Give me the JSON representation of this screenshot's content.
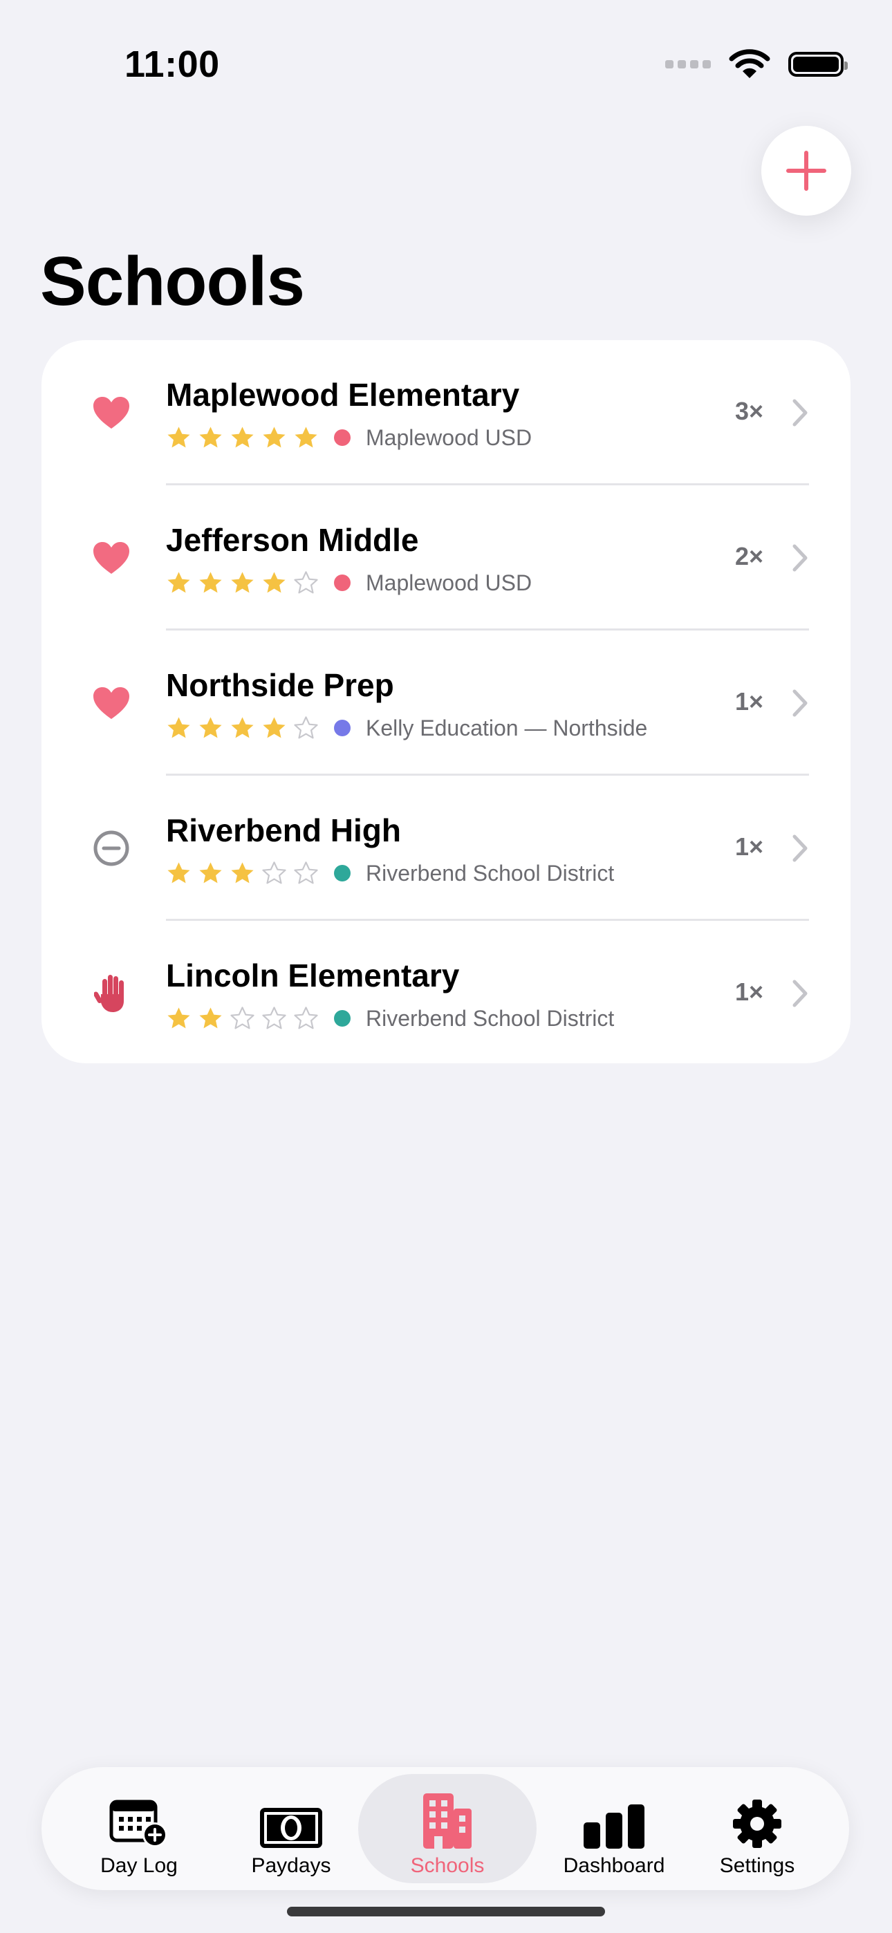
{
  "status_bar": {
    "time": "11:00"
  },
  "header": {
    "title": "Schools",
    "add_icon": "plus-icon"
  },
  "colors": {
    "accent": "#F0647A",
    "star": "#F5C242",
    "favorite": "#F26B81",
    "blocked": "#D6455E",
    "neutral": "#8E8E93"
  },
  "schools": [
    {
      "name": "Maplewood Elementary",
      "rating": 5,
      "status_icon": "heart-icon",
      "district": "Maplewood USD",
      "district_color": "#F0647A",
      "count": "3×"
    },
    {
      "name": "Jefferson Middle",
      "rating": 4,
      "status_icon": "heart-icon",
      "district": "Maplewood USD",
      "district_color": "#F0647A",
      "count": "2×"
    },
    {
      "name": "Northside Prep",
      "rating": 4,
      "status_icon": "heart-icon",
      "district": "Kelly Education — Northside",
      "district_color": "#7679E8",
      "count": "1×"
    },
    {
      "name": "Riverbend High",
      "rating": 3,
      "status_icon": "minus-circle-icon",
      "district": "Riverbend School District",
      "district_color": "#2EA89A",
      "count": "1×"
    },
    {
      "name": "Lincoln Elementary",
      "rating": 2,
      "status_icon": "hand-raised-icon",
      "district": "Riverbend School District",
      "district_color": "#2EA89A",
      "count": "1×"
    }
  ],
  "tabs": [
    {
      "label": "Day Log",
      "icon": "calendar-add-icon",
      "active": false
    },
    {
      "label": "Paydays",
      "icon": "banknote-icon",
      "active": false
    },
    {
      "label": "Schools",
      "icon": "building-icon",
      "active": true
    },
    {
      "label": "Dashboard",
      "icon": "bar-chart-icon",
      "active": false
    },
    {
      "label": "Settings",
      "icon": "gear-icon",
      "active": false
    }
  ]
}
